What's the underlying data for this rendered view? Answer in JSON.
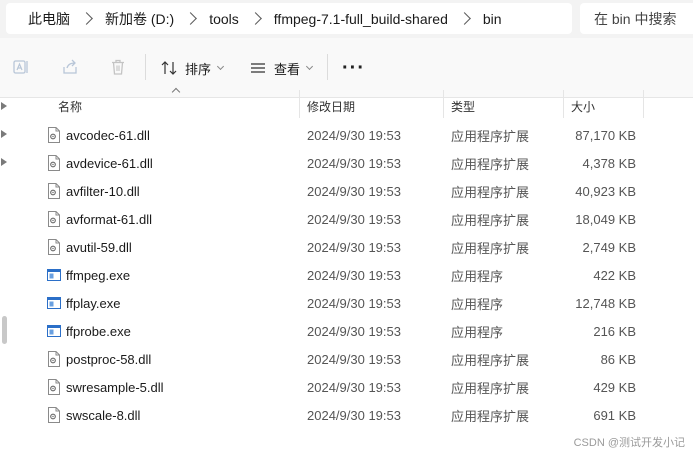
{
  "address": {
    "crumbs": [
      "此电脑",
      "新加卷 (D:)",
      "tools",
      "ffmpeg-7.1-full_build-shared",
      "bin"
    ]
  },
  "search": {
    "placeholder": "在 bin 中搜索"
  },
  "toolbar": {
    "sort_label": "排序",
    "view_label": "查看",
    "more_label": "···"
  },
  "columns": {
    "name": "名称",
    "date": "修改日期",
    "type": "类型",
    "size": "大小"
  },
  "files": [
    {
      "name": "avcodec-61.dll",
      "icon": "dll-file-icon",
      "date": "2024/9/30 19:53",
      "type": "应用程序扩展",
      "size": "87,170 KB"
    },
    {
      "name": "avdevice-61.dll",
      "icon": "dll-file-icon",
      "date": "2024/9/30 19:53",
      "type": "应用程序扩展",
      "size": "4,378 KB"
    },
    {
      "name": "avfilter-10.dll",
      "icon": "dll-file-icon",
      "date": "2024/9/30 19:53",
      "type": "应用程序扩展",
      "size": "40,923 KB"
    },
    {
      "name": "avformat-61.dll",
      "icon": "dll-file-icon",
      "date": "2024/9/30 19:53",
      "type": "应用程序扩展",
      "size": "18,049 KB"
    },
    {
      "name": "avutil-59.dll",
      "icon": "dll-file-icon",
      "date": "2024/9/30 19:53",
      "type": "应用程序扩展",
      "size": "2,749 KB"
    },
    {
      "name": "ffmpeg.exe",
      "icon": "exe-file-icon",
      "date": "2024/9/30 19:53",
      "type": "应用程序",
      "size": "422 KB"
    },
    {
      "name": "ffplay.exe",
      "icon": "exe-file-icon",
      "date": "2024/9/30 19:53",
      "type": "应用程序",
      "size": "12,748 KB"
    },
    {
      "name": "ffprobe.exe",
      "icon": "exe-file-icon",
      "date": "2024/9/30 19:53",
      "type": "应用程序",
      "size": "216 KB"
    },
    {
      "name": "postproc-58.dll",
      "icon": "dll-file-icon",
      "date": "2024/9/30 19:53",
      "type": "应用程序扩展",
      "size": "86 KB"
    },
    {
      "name": "swresample-5.dll",
      "icon": "dll-file-icon",
      "date": "2024/9/30 19:53",
      "type": "应用程序扩展",
      "size": "429 KB"
    },
    {
      "name": "swscale-8.dll",
      "icon": "dll-file-icon",
      "date": "2024/9/30 19:53",
      "type": "应用程序扩展",
      "size": "691 KB"
    }
  ],
  "watermark": "CSDN @测试开发小记",
  "colors": {
    "exe_icon": "#2b6fc8",
    "dll_icon": "#8a8a8a",
    "toolbar_bg": "#f9f9f9"
  }
}
